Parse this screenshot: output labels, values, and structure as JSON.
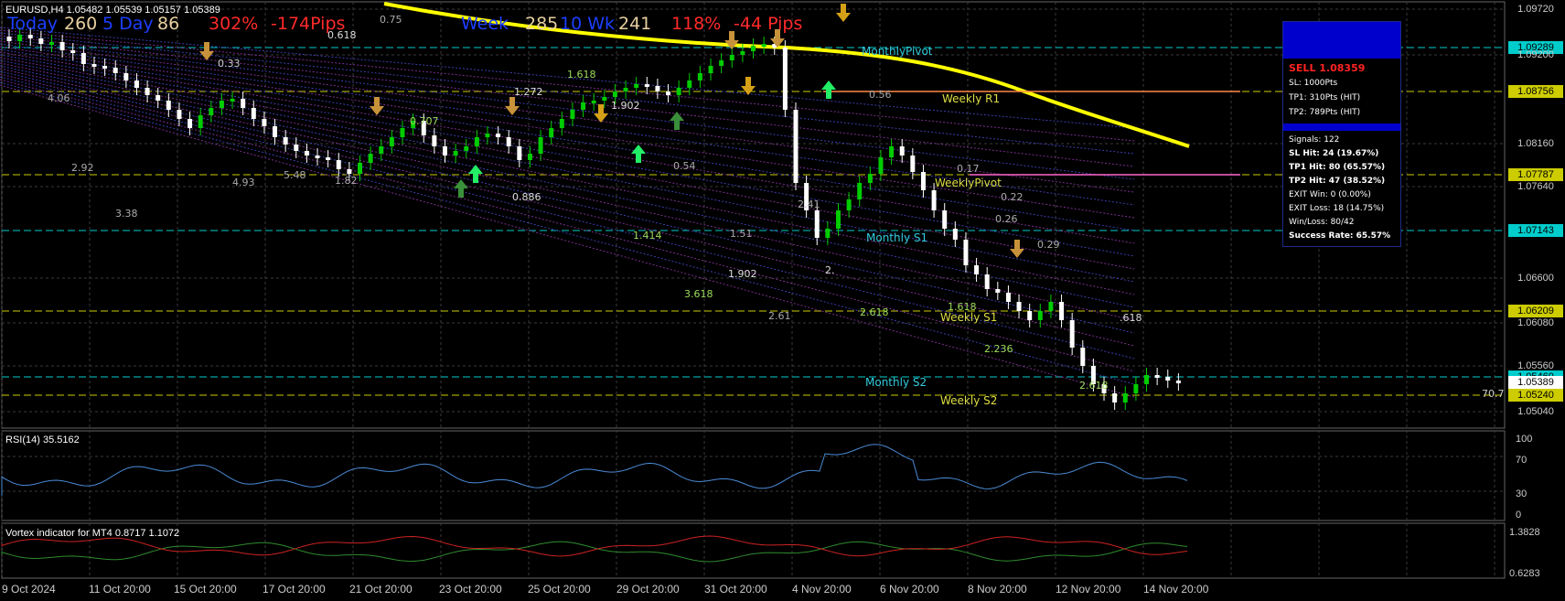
{
  "window": {
    "title_bar": "EURUSD,H4  1.05482 1.05539 1.05157 1.05389"
  },
  "header_stats": {
    "today": "Today",
    "today_val": "260",
    "day5": "5 Day",
    "day5_val": "86",
    "pct": "302%",
    "pips": "-174Pips",
    "week": "Week",
    "week_val": "285",
    "wk10": "10 Wk",
    "wk10_val": "241",
    "wpct": "118%",
    "wpips": "-44  Pips"
  },
  "price_labels": [
    {
      "label": "1.09720",
      "bg": "none",
      "color": "#ccc"
    },
    {
      "label": "1.09289",
      "bg": "#00cccc",
      "color": "#000"
    },
    {
      "label": "1.09200",
      "bg": "none",
      "color": "#ccc"
    },
    {
      "label": "1.08756",
      "bg": "#cccc00",
      "color": "#000"
    },
    {
      "label": "1.08160",
      "bg": "none",
      "color": "#ccc"
    },
    {
      "label": "1.07787",
      "bg": "#cccc00",
      "color": "#000"
    },
    {
      "label": "1.07640",
      "bg": "none",
      "color": "#ccc"
    },
    {
      "label": "1.07143",
      "bg": "#00cccc",
      "color": "#000"
    },
    {
      "label": "1.06600",
      "bg": "none",
      "color": "#ccc"
    },
    {
      "label": "1.06209",
      "bg": "#cccc00",
      "color": "#000"
    },
    {
      "label": "1.06080",
      "bg": "none",
      "color": "#ccc"
    },
    {
      "label": "1.05560",
      "bg": "none",
      "color": "#ccc"
    },
    {
      "label": "1.05460",
      "bg": "#00cccc",
      "color": "#000"
    },
    {
      "label": "1.05389",
      "bg": "#ffffff",
      "color": "#000"
    },
    {
      "label": "1.05240",
      "bg": "#cccc00",
      "color": "#000"
    },
    {
      "label": "1.05040",
      "bg": "none",
      "color": "#ccc"
    }
  ],
  "pivot_labels": {
    "monthly_pivot": "MonthlyPivot",
    "weekly_r1": "Weekly R1",
    "weekly_pivot": "WeeklyPivot",
    "monthly_s1": "Monthly S1",
    "weekly_s1": "Weekly S1",
    "monthly_s2": "Monthly S2",
    "weekly_s2": "Weekly S2",
    "level_707": "70.7"
  },
  "fib_labels": [
    "0.75",
    "0.618",
    "0.33",
    "1.618",
    "1.272",
    "1.902",
    "0.707",
    "4.06",
    "2.92",
    "4.93",
    "5.48",
    "1.82",
    "3.38",
    "0.886",
    "0.54",
    "1.414",
    "1.51",
    "2.41",
    "1.902",
    "3.618",
    "2.61",
    "2.618",
    "1.618",
    "0.56",
    "0.17",
    "0.22",
    "0.26",
    "0.29",
    "2.236",
    "2.618",
    ".618",
    "2."
  ],
  "signal_panel": {
    "sell": "SELL 1.08359",
    "sl": "SL: 1000Pts",
    "tp1": "TP1: 310Pts (HIT)",
    "tp2": "TP2: 789Pts (HIT)",
    "signals": "Signals: 122",
    "sl_hit": "SL Hit: 24 (19.67%)",
    "tp1_hit": "TP1 Hit: 80 (65.57%)",
    "tp2_hit": "TP2 Hit: 47 (38.52%)",
    "exit_win": "EXIT Win: 0 (0.00%)",
    "exit_loss": "EXIT Loss: 18 (14.75%)",
    "win_loss": "Win/Loss: 80/42",
    "success": "Success Rate: 65.57%"
  },
  "rsi": {
    "title": "RSI(14) 35.5162",
    "ticks": [
      "100",
      "70",
      "30",
      "0"
    ]
  },
  "vortex": {
    "title": "Vortex indicator for MT4 0.8717 1.1072",
    "ticks": [
      "1.3828",
      "0.6283"
    ]
  },
  "dates": [
    "9 Oct 2024",
    "11 Oct 20:00",
    "15 Oct 20:00",
    "17 Oct 20:00",
    "21 Oct 20:00",
    "23 Oct 20:00",
    "25 Oct 20:00",
    "29 Oct 20:00",
    "31 Oct 20:00",
    "4 Nov 20:00",
    "6 Nov 20:00",
    "8 Nov 20:00",
    "12 Nov 20:00",
    "14 Nov 20:00"
  ],
  "colors": {
    "bull": "#00cc00",
    "bear": "#ffffff",
    "ma": "#ffff00",
    "rsi": "#4a8bd6",
    "vortex_plus": "#2e8b2e",
    "vortex_minus": "#cc2222"
  }
}
